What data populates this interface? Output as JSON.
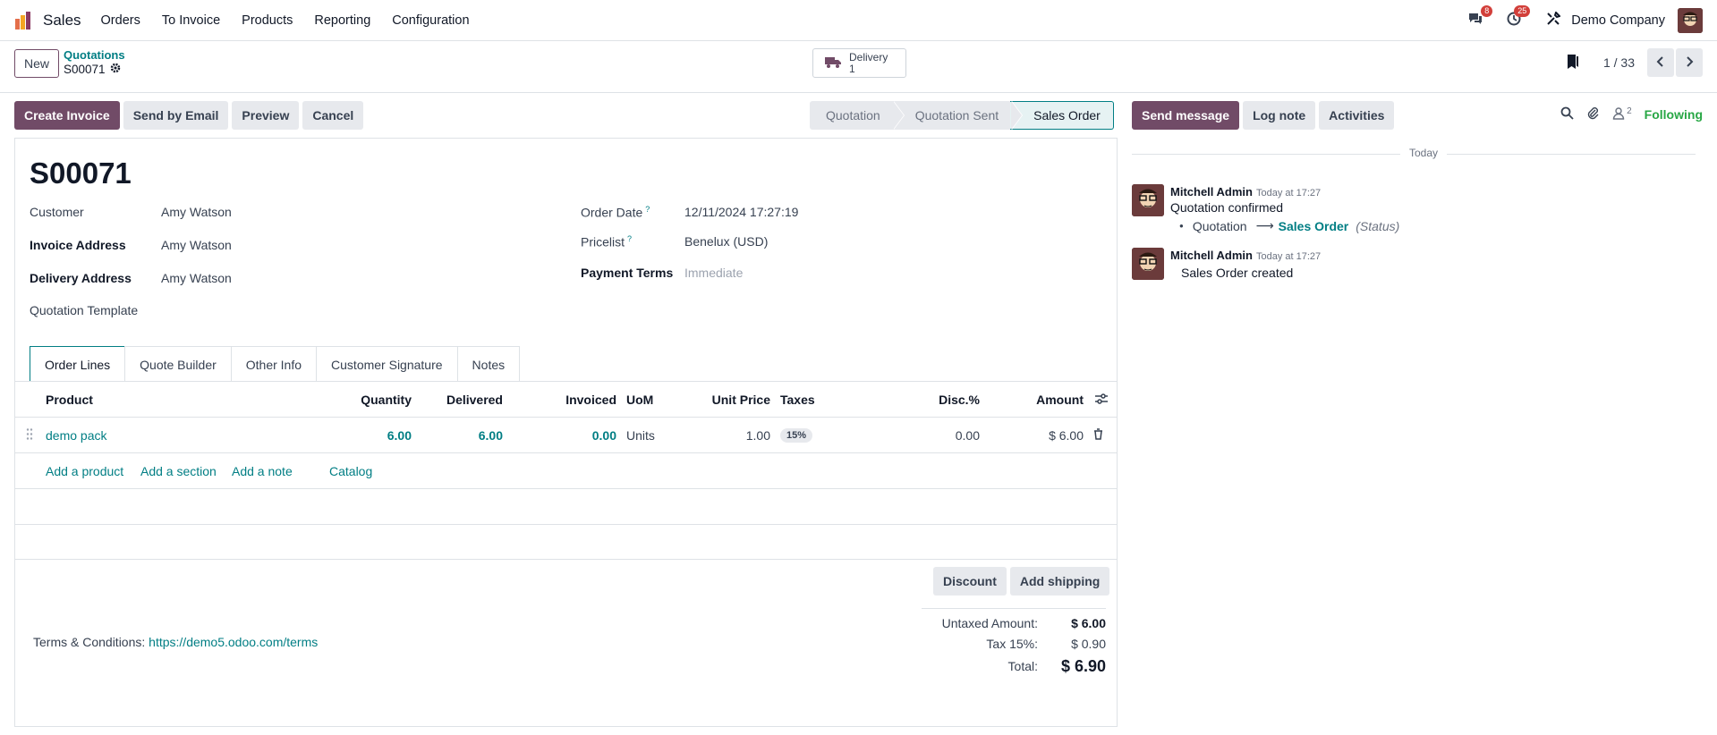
{
  "navbar": {
    "app_name": "Sales",
    "menu": [
      "Orders",
      "To Invoice",
      "Products",
      "Reporting",
      "Configuration"
    ],
    "messages_badge": "8",
    "activities_badge": "25",
    "company": "Demo Company"
  },
  "control": {
    "new_label": "New",
    "breadcrumb_parent": "Quotations",
    "breadcrumb_current": "S00071",
    "delivery_label": "Delivery",
    "delivery_count": "1",
    "pager": "1 / 33"
  },
  "actions": {
    "create_invoice": "Create Invoice",
    "send_email": "Send by Email",
    "preview": "Preview",
    "cancel": "Cancel"
  },
  "statusbar": [
    "Quotation",
    "Quotation Sent",
    "Sales Order"
  ],
  "chatter_buttons": {
    "send_message": "Send message",
    "log_note": "Log note",
    "activities": "Activities",
    "followers_count": "2",
    "following": "Following"
  },
  "form": {
    "title": "S00071",
    "customer_label": "Customer",
    "customer": "Amy Watson",
    "invoice_address_label": "Invoice Address",
    "invoice_address": "Amy Watson",
    "delivery_address_label": "Delivery Address",
    "delivery_address": "Amy Watson",
    "template_label": "Quotation Template",
    "order_date_label": "Order Date",
    "order_date": "12/11/2024 17:27:19",
    "pricelist_label": "Pricelist",
    "pricelist": "Benelux (USD)",
    "payment_terms_label": "Payment Terms",
    "payment_terms_placeholder": "Immediate",
    "help_mark": "?"
  },
  "tabs": [
    "Order Lines",
    "Quote Builder",
    "Other Info",
    "Customer Signature",
    "Notes"
  ],
  "lines": {
    "headers": {
      "product": "Product",
      "quantity": "Quantity",
      "delivered": "Delivered",
      "invoiced": "Invoiced",
      "uom": "UoM",
      "unit_price": "Unit Price",
      "taxes": "Taxes",
      "disc": "Disc.%",
      "amount": "Amount"
    },
    "rows": [
      {
        "product": "demo pack",
        "quantity": "6.00",
        "delivered": "6.00",
        "invoiced": "0.00",
        "uom": "Units",
        "unit_price": "1.00",
        "taxes": "15%",
        "disc": "0.00",
        "amount": "$ 6.00"
      }
    ],
    "add_product": "Add a product",
    "add_section": "Add a section",
    "add_note": "Add a note",
    "catalog": "Catalog"
  },
  "bottom": {
    "discount": "Discount",
    "add_shipping": "Add shipping",
    "terms_label": "Terms & Conditions:",
    "terms_link": "https://demo5.odoo.com/terms",
    "untaxed_label": "Untaxed Amount:",
    "untaxed": "$ 6.00",
    "tax_label": "Tax 15%:",
    "tax": "$ 0.90",
    "total_label": "Total:",
    "total": "$ 6.90"
  },
  "chatter": {
    "today": "Today",
    "messages": [
      {
        "author": "Mitchell Admin",
        "time": "Today at 17:27",
        "text": "Quotation confirmed",
        "change_from": "Quotation",
        "change_to": "Sales Order",
        "change_field": "(Status)"
      },
      {
        "author": "Mitchell Admin",
        "time": "Today at 17:27",
        "text": "Sales Order created"
      }
    ]
  }
}
